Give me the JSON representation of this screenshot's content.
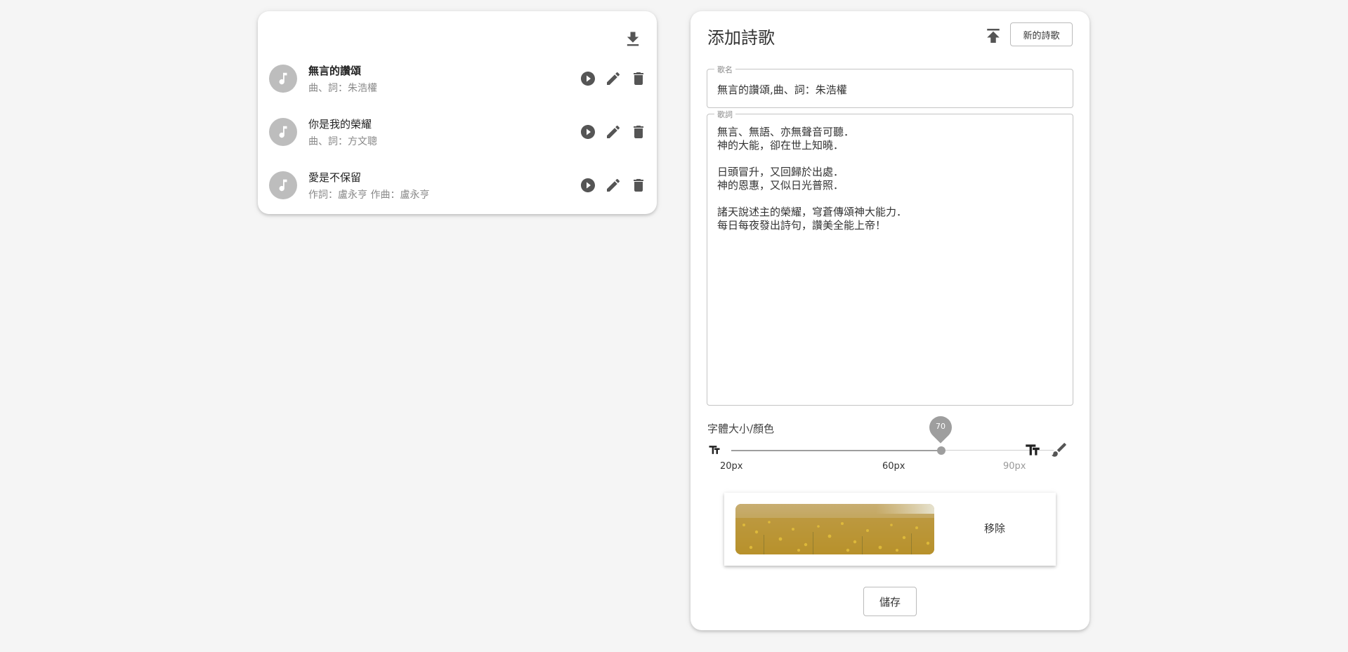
{
  "songs": [
    {
      "title": "無言的讚頌",
      "subtitle": "曲、詞：朱浩權"
    },
    {
      "title": "你是我的榮耀",
      "subtitle": "曲、詞：方文聰"
    },
    {
      "title": "愛是不保留",
      "subtitle": "作詞：盧永亨 作曲：盧永亨"
    }
  ],
  "editor": {
    "title": "添加詩歌",
    "new_button": "新的詩歌",
    "name_legend": "歌名",
    "name_value": "無言的讚頌,曲、詞：朱浩權",
    "lyrics_legend": "歌詞",
    "lyrics_value": "無言、無語、亦無聲音可聽．\n神的大能，卻在世上知曉．\n\n日頭冒升，又回歸於出處．\n神的恩惠，又似日光普照．\n\n諸天說述主的榮耀，穹蒼傳頌神大能力．\n每日每夜發出詩句，讚美全能上帝！",
    "font_label": "字體大小/顏色",
    "slider": {
      "value": "70",
      "value_fraction": 0.7,
      "marks": [
        "20px",
        "60px",
        "90px"
      ]
    },
    "remove_button": "移除",
    "save_button": "儲存"
  },
  "icons": {
    "download": "download-icon",
    "upload": "upload-icon",
    "music": "music-note-icon",
    "play": "play-circle-icon",
    "edit": "pencil-icon",
    "delete": "trash-icon",
    "text_size": "text-size-icon",
    "brush": "brush-icon"
  },
  "colors": {
    "icon": "#616161",
    "avatar": "#bdbdbd",
    "slider": "#9e9e9e"
  }
}
